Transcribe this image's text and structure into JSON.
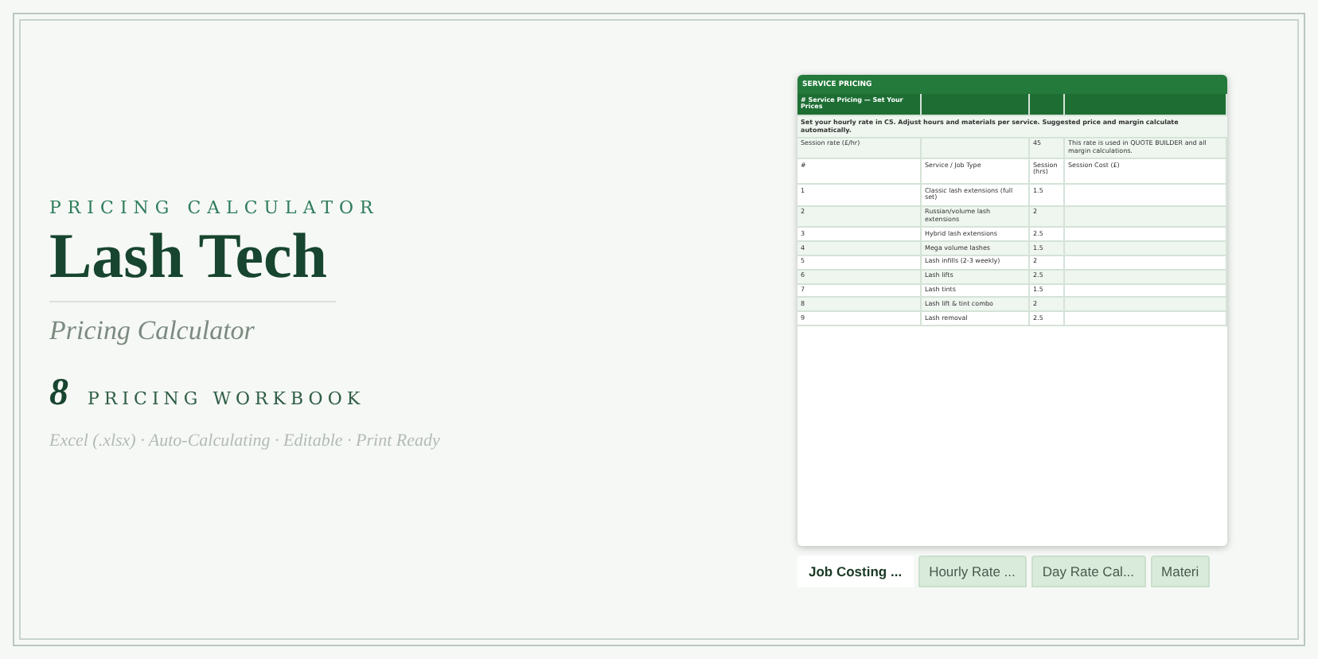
{
  "hero": {
    "eyebrow": "PRICING CALCULATOR",
    "title": "Lash Tech",
    "subtitle": "Pricing Calculator",
    "count": "8",
    "count_label": "PRICING WORKBOOK",
    "features": "Excel (.xlsx) · Auto-Calculating · Editable · Print Ready"
  },
  "sheet": {
    "banner": "SERVICE PRICING",
    "section_title": "# Service Pricing — Set Your Prices",
    "note": "Set your hourly rate in C5. Adjust hours and materials per service. Suggested price and margin calculate automatically.",
    "rate_row": {
      "label": "Session rate (£/hr)",
      "value": "45",
      "note": "This rate is used in QUOTE BUILDER and all margin calculations."
    },
    "columns": [
      "#",
      "Service / Job Type",
      "Session (hrs)",
      "Session Cost (£)"
    ],
    "rows": [
      {
        "number": "1",
        "service": "Classic lash extensions (full set)",
        "hours": "1.5"
      },
      {
        "number": "2",
        "service": "Russian/volume lash extensions",
        "hours": "2"
      },
      {
        "number": "3",
        "service": "Hybrid lash extensions",
        "hours": "2.5"
      },
      {
        "number": "4",
        "service": "Mega volume lashes",
        "hours": "1.5"
      },
      {
        "number": "5",
        "service": "Lash infills (2-3 weekly)",
        "hours": "2"
      },
      {
        "number": "6",
        "service": "Lash lifts",
        "hours": "2.5"
      },
      {
        "number": "7",
        "service": "Lash tints",
        "hours": "1.5"
      },
      {
        "number": "8",
        "service": "Lash lift & tint combo",
        "hours": "2"
      },
      {
        "number": "9",
        "service": "Lash removal",
        "hours": "2.5"
      }
    ],
    "tabs": [
      {
        "label": "Job Costing ...",
        "selected": true
      },
      {
        "label": "Hourly Rate ...",
        "selected": false
      },
      {
        "label": "Day Rate Cal...",
        "selected": false
      },
      {
        "label": "Materi",
        "selected": false
      }
    ]
  }
}
